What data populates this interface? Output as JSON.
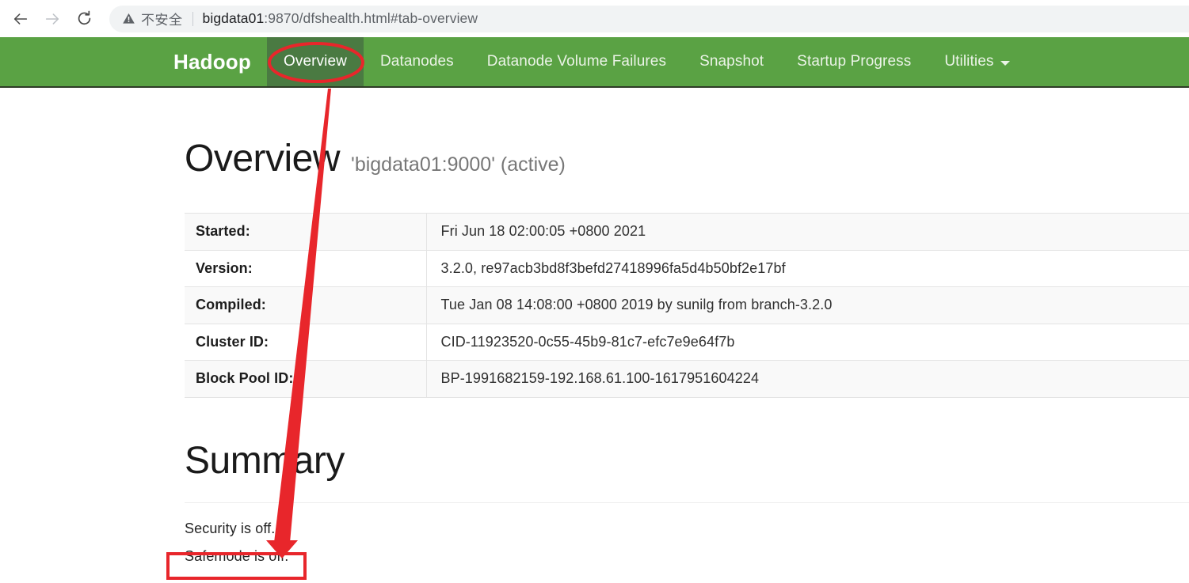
{
  "browser": {
    "back_icon": "arrow-left-icon",
    "forward_icon": "arrow-right-icon",
    "reload_icon": "reload-icon",
    "security_icon": "warning-triangle-icon",
    "security_label": "不安全",
    "url_host": "bigdata01",
    "url_path": ":9870/dfshealth.html#tab-overview",
    "url_full": "bigdata01:9870/dfshealth.html#tab-overview"
  },
  "navbar": {
    "brand": "Hadoop",
    "background_color": "#5aa244",
    "active_background_color": "#4a7a42",
    "items": [
      {
        "label": "Overview",
        "active": true
      },
      {
        "label": "Datanodes",
        "active": false
      },
      {
        "label": "Datanode Volume Failures",
        "active": false
      },
      {
        "label": "Snapshot",
        "active": false
      },
      {
        "label": "Startup Progress",
        "active": false
      },
      {
        "label": "Utilities",
        "active": false,
        "caret": "chevron-down-icon"
      }
    ]
  },
  "overview": {
    "heading": "Overview",
    "subtitle": "'bigdata01:9000' (active)",
    "table": {
      "rows": [
        {
          "key": "Started:",
          "value": "Fri Jun 18 02:00:05 +0800 2021"
        },
        {
          "key": "Version:",
          "value": "3.2.0, re97acb3bd8f3befd27418996fa5d4b50bf2e17bf"
        },
        {
          "key": "Compiled:",
          "value": "Tue Jan 08 14:08:00 +0800 2019 by sunilg from branch-3.2.0"
        },
        {
          "key": "Cluster ID:",
          "value": "CID-11923520-0c55-45b9-81c7-efc7e9e64f7b"
        },
        {
          "key": "Block Pool ID:",
          "value": "BP-1991682159-192.168.61.100-1617951604224"
        }
      ]
    }
  },
  "summary": {
    "heading": "Summary",
    "security_status": "Security is off.",
    "safemode_status": "Safemode is off."
  },
  "annotations": {
    "color": "#e8262b",
    "ellipse_target": "Overview",
    "box_target": "Safemode is off.",
    "arrow": "from Overview tab to Safemode is off."
  }
}
